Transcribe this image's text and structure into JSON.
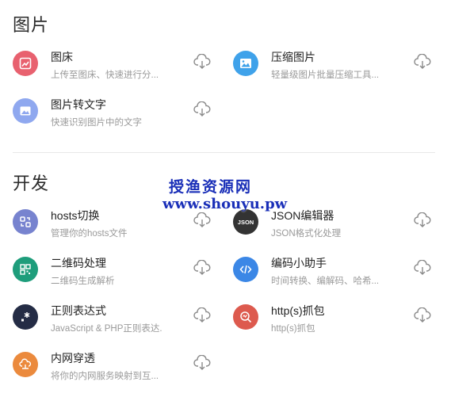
{
  "sections": [
    {
      "title": "图片"
    },
    {
      "title": "开发"
    }
  ],
  "tools": [
    {
      "name": "图床",
      "desc": "上传至图床、快速进行分...",
      "icon": "image-edit-icon",
      "color": "#e8616f"
    },
    {
      "name": "压缩图片",
      "desc": "轻量级图片批量压缩工具...",
      "icon": "image-compress-icon",
      "color": "#3fa2ea"
    },
    {
      "name": "图片转文字",
      "desc": "快速识别图片中的文字",
      "icon": "image-text-icon",
      "color": "#8fa8ef"
    },
    {
      "name": "hosts切换",
      "desc": "管理你的hosts文件",
      "icon": "switch-icon",
      "color": "#7783cf"
    },
    {
      "name": "JSON编辑器",
      "desc": "JSON格式化处理",
      "icon": "json-icon",
      "color": "#333333",
      "icon_text": "JSON"
    },
    {
      "name": "二维码处理",
      "desc": "二维码生成解析",
      "icon": "qrcode-icon",
      "color": "#1e9d7b"
    },
    {
      "name": "编码小助手",
      "desc": "时间转换、编解码、哈希...",
      "icon": "code-icon",
      "color": "#3b87e6"
    },
    {
      "name": "正则表达式",
      "desc": "JavaScript & PHP正则表达...",
      "icon": "regex-icon",
      "color": "#242c45"
    },
    {
      "name": "http(s)抓包",
      "desc": "http(s)抓包",
      "icon": "capture-icon",
      "color": "#dd5a4e"
    },
    {
      "name": "内网穿透",
      "desc": "将你的内网服务映射到互...",
      "icon": "cloud-network-icon",
      "color": "#eb8a3d"
    }
  ],
  "watermark": {
    "title": "授渔资源网",
    "url": "www.shouyu.pw"
  }
}
